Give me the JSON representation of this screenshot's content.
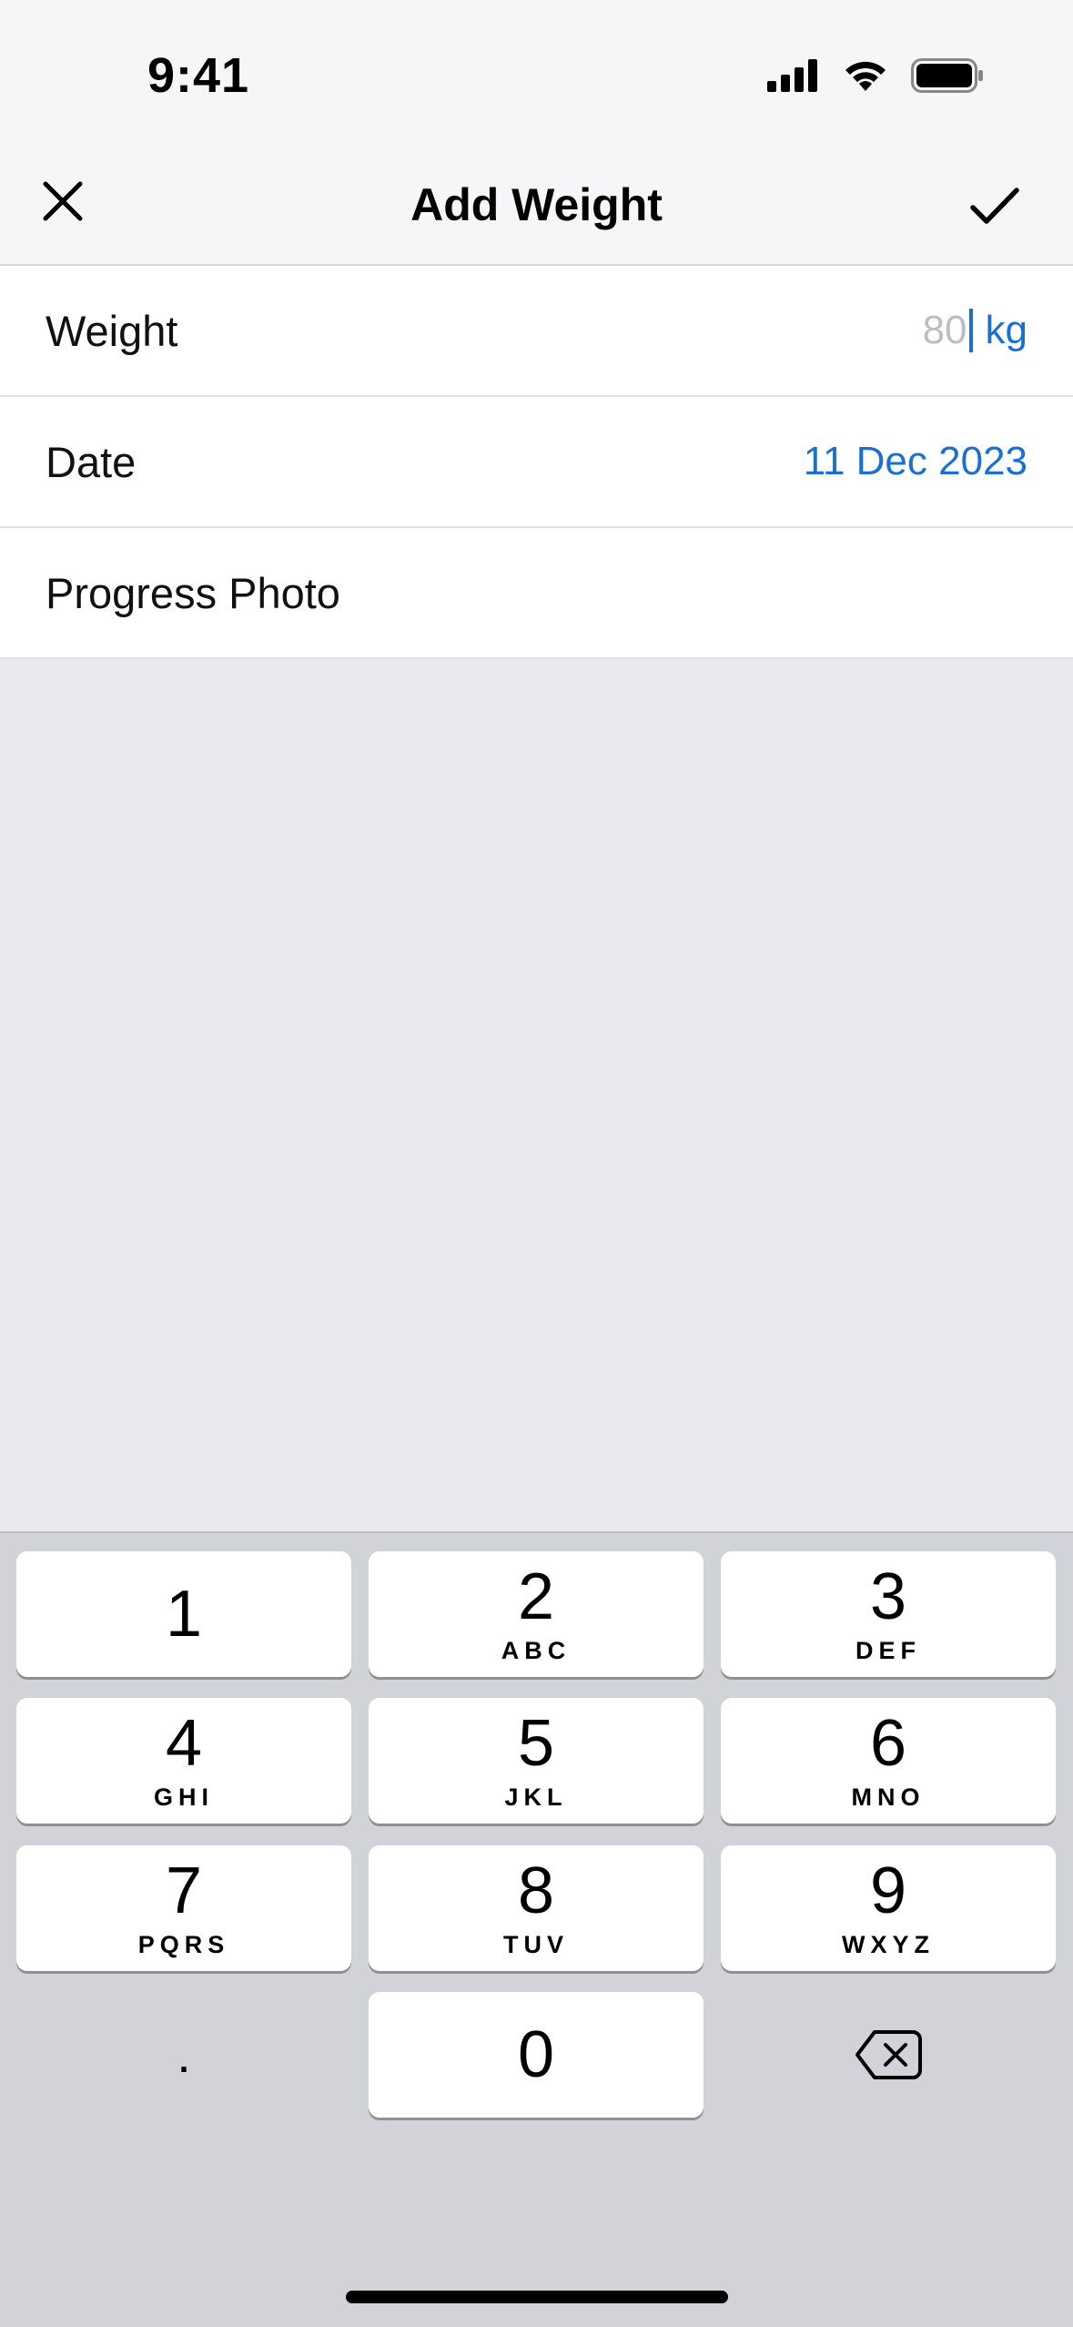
{
  "status_bar": {
    "time": "9:41",
    "icons": [
      "cellular-signal-icon",
      "wifi-icon",
      "battery-icon"
    ]
  },
  "nav": {
    "title": "Add Weight",
    "close_icon": "close-icon",
    "done_icon": "checkmark-icon"
  },
  "form": {
    "weight": {
      "label": "Weight",
      "placeholder": "80",
      "unit": "kg"
    },
    "date": {
      "label": "Date",
      "value": "11 Dec 2023"
    },
    "photo": {
      "label": "Progress Photo"
    }
  },
  "keypad": {
    "keys": [
      {
        "digit": "1",
        "letters": ""
      },
      {
        "digit": "2",
        "letters": "ABC"
      },
      {
        "digit": "3",
        "letters": "DEF"
      },
      {
        "digit": "4",
        "letters": "GHI"
      },
      {
        "digit": "5",
        "letters": "JKL"
      },
      {
        "digit": "6",
        "letters": "MNO"
      },
      {
        "digit": "7",
        "letters": "PQRS"
      },
      {
        "digit": "8",
        "letters": "TUV"
      },
      {
        "digit": "9",
        "letters": "WXYZ"
      },
      {
        "digit": "0",
        "letters": ""
      }
    ],
    "decimal": ".",
    "delete_icon": "backspace-icon"
  },
  "colors": {
    "accent": "#1a70d2",
    "placeholder": "#bdbdc2",
    "keyboard_bg": "#d1d3d9"
  }
}
